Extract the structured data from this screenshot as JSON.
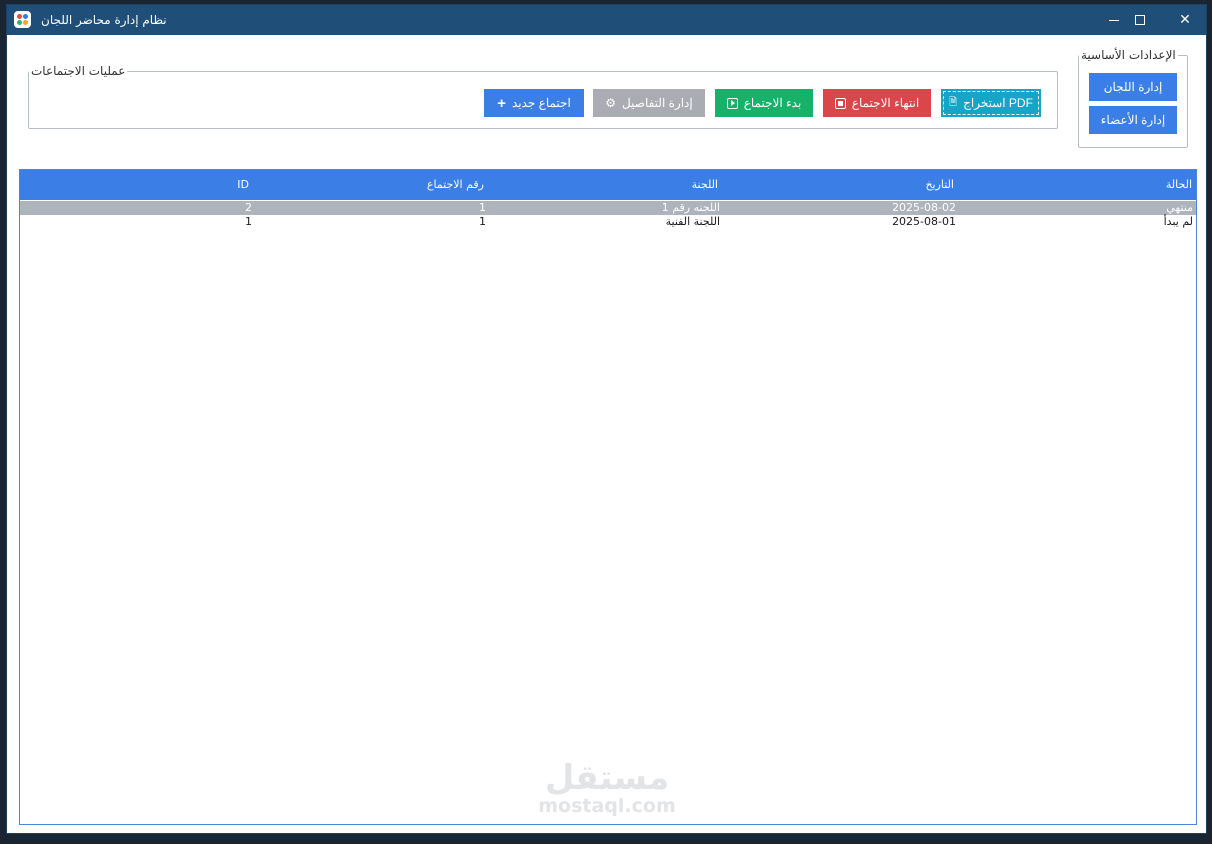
{
  "window": {
    "title": "نظام إدارة محاضر اللجان",
    "controls": {
      "minimize": "",
      "maximize": "",
      "close": "✕"
    }
  },
  "settings_group": {
    "legend": "الإعدادات الأساسية",
    "manage_committees": "إدارة اللجان",
    "manage_members": "إدارة الأعضاء"
  },
  "operations_group": {
    "legend": "عمليات الاجتماعات",
    "buttons": {
      "pdf_export": "PDF استخراج",
      "end_meeting": "انتهاء الاجتماع",
      "start_meeting": "بدء الاجتماع",
      "manage_details": "إدارة التفاصيل",
      "new_meeting": "اجتماع جديد"
    },
    "colors": {
      "blue": "#3b7fe6",
      "gray": "#a9adb3",
      "green": "#17b26a",
      "red": "#d9474a",
      "teal": "#14a5c7"
    }
  },
  "table": {
    "columns": {
      "status": "الحالة",
      "date": "التاريخ",
      "committee": "اللجنة",
      "meeting_number": "رقم الاجتماع",
      "id": "ID"
    },
    "rows": [
      {
        "status": "منتهي",
        "date": "2025-08-02",
        "committee": "اللجنه رقم 1",
        "meeting_number": "1",
        "id": "2",
        "selected": true
      },
      {
        "status": "لم يبدأ",
        "date": "2025-08-01",
        "committee": "اللجنة الفنية",
        "meeting_number": "1",
        "id": "1",
        "selected": false
      }
    ],
    "header_color": "#3b7fe6"
  },
  "watermark": {
    "arabic": "مستقل",
    "latin": "mostaql.com"
  },
  "icons": {
    "app": "app-logo-icon",
    "plus": "plus-icon",
    "gear": "gear-icon",
    "play": "play-icon",
    "stop": "stop-icon",
    "document": "document-icon"
  }
}
